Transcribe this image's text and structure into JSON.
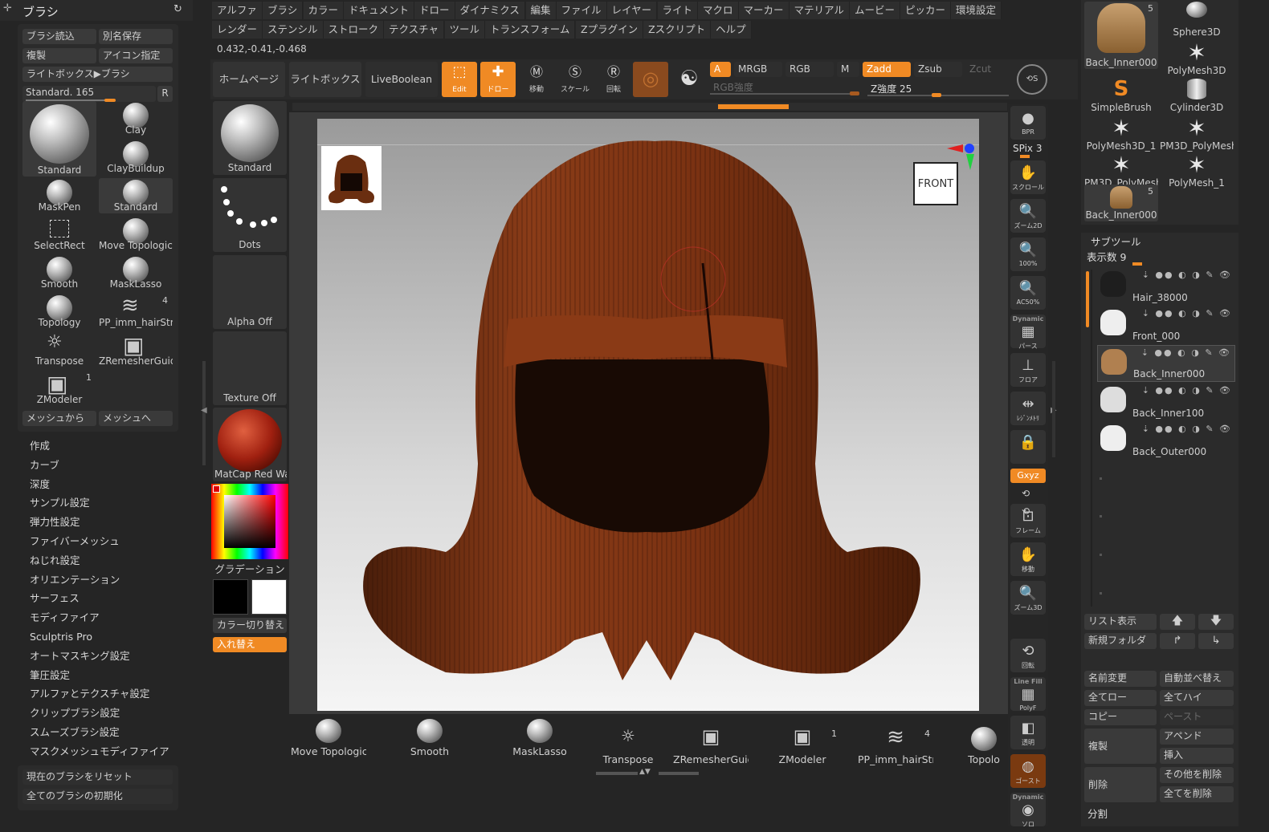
{
  "left": {
    "title": "ブラシ",
    "btns": [
      "ブラシ読込",
      "別名保存",
      "複製",
      "アイコン指定",
      "ライトボックス▶ブラシ"
    ],
    "current": "Standard. 165",
    "r": "R",
    "brushes": [
      {
        "name": "Standard",
        "kind": "sphere",
        "num": ""
      },
      {
        "name": "Clay",
        "kind": "sphere",
        "num": ""
      },
      {
        "name": "ClayBuildup",
        "kind": "sphere",
        "num": ""
      },
      {
        "name": "MaskPen",
        "kind": "sphere",
        "num": ""
      },
      {
        "name": "Standard",
        "kind": "sphere",
        "num": ""
      },
      {
        "name": "SelectRect",
        "kind": "rect",
        "num": ""
      },
      {
        "name": "Move Topologica",
        "kind": "sphere",
        "num": ""
      },
      {
        "name": "Smooth",
        "kind": "sphere",
        "num": ""
      },
      {
        "name": "MaskLasso",
        "kind": "sphere",
        "num": ""
      },
      {
        "name": "Topology",
        "kind": "sphere",
        "num": ""
      },
      {
        "name": "PP_imm_hairStr",
        "kind": "hair",
        "num": "4"
      },
      {
        "name": "Transpose",
        "kind": "gear",
        "num": ""
      },
      {
        "name": "ZRemesherGuide",
        "kind": "cube",
        "num": ""
      },
      {
        "name": "ZModeler",
        "kind": "cube",
        "num": "1"
      }
    ],
    "meshFrom": "メッシュから",
    "meshTo": "メッシュへ",
    "menu": [
      "作成",
      "カーブ",
      "深度",
      "サンプル設定",
      "弾力性設定",
      "ファイバーメッシュ",
      "ねじれ設定",
      "オリエンテーション",
      "サーフェス",
      "モディファイア",
      "Sculptris Pro",
      "オートマスキング設定",
      "筆圧設定",
      "アルファとテクスチャ設定",
      "クリップブラシ設定",
      "スムーズブラシ設定",
      "マスクメッシュモディファイア"
    ],
    "reset": "現在のブラシをリセット",
    "initAll": "全てのブラシの初期化"
  },
  "menubar": {
    "row1": [
      "アルファ",
      "ブラシ",
      "カラー",
      "ドキュメント",
      "ドロー",
      "ダイナミクス",
      "編集",
      "ファイル",
      "レイヤー",
      "ライト",
      "マクロ",
      "マーカー",
      "マテリアル",
      "ムービー",
      "ピッカー",
      "環境設定"
    ],
    "row2": [
      "レンダー",
      "ステンシル",
      "ストローク",
      "テクスチャ",
      "ツール",
      "トランスフォーム",
      "Zプラグイン",
      "Zスクリプト",
      "ヘルプ"
    ]
  },
  "coords": "0.432,-0.41,-0.468",
  "toolbar": {
    "home": "ホームページ",
    "lightbox": "ライトボックス",
    "liveboolean": "LiveBoolean",
    "edit": "Edit",
    "draw": "ドロー",
    "move": "移動",
    "scale": "スケール",
    "rotate": "回転",
    "a": "A",
    "mrgb": "MRGB",
    "rgb": "RGB",
    "m": "M",
    "zadd": "Zadd",
    "zsub": "Zsub",
    "zcut": "Zcut",
    "rgbIntensity": "RGB強度",
    "zIntensity": "Z強度 25"
  },
  "shelf": {
    "standard": "Standard",
    "dots": "Dots",
    "alpha": "Alpha Off",
    "texture": "Texture Off",
    "matcap": "MatCap Red Wa:",
    "gradation": "グラデーション",
    "colorSwitch": "カラー切り替え",
    "swap": "入れ替え"
  },
  "canvas": {
    "front": "FRONT"
  },
  "rightbar": {
    "bpr": "BPR",
    "spix": "SPix 3",
    "scroll": "スクロール",
    "zoom2d": "ズーム2D",
    "z100": "100%",
    "ac50": "AC50%",
    "dynamic": "Dynamic",
    "perspective": "パース",
    "floor": "フロア",
    "localsym": "ﾚｼﾞﾝﾒﾄﾘ",
    "xyz": "Gxyz",
    "frame": "フレーム",
    "move": "移動",
    "zoom3d": "ズーム3D",
    "rotate": "回転",
    "linefill": "Line Fill",
    "polyf": "PolyF",
    "transp": "透明",
    "ghost": "ゴースト",
    "solo": "ソロ"
  },
  "tools": [
    {
      "name": "Back_Inner000",
      "num": "5",
      "kind": "hair"
    },
    {
      "name": "Sphere3D",
      "num": "",
      "kind": "sphere"
    },
    {
      "name": "PolyMesh3D",
      "num": "",
      "kind": "star"
    },
    {
      "name": "SimpleBrush",
      "num": "",
      "kind": "s"
    },
    {
      "name": "Cylinder3D",
      "num": "",
      "kind": "cyl"
    },
    {
      "name": "PolyMesh3D_1",
      "num": "",
      "kind": "star"
    },
    {
      "name": "PM3D_PolyMesh",
      "num": "",
      "kind": "star"
    },
    {
      "name": "PM3D_PolyMesh",
      "num": "",
      "kind": "star"
    },
    {
      "name": "PolyMesh_1",
      "num": "",
      "kind": "star"
    },
    {
      "name": "Back_Inner000",
      "num": "5",
      "kind": "hair"
    }
  ],
  "subtool": {
    "title": "サブツール",
    "count": "表示数 9",
    "items": [
      "Hair_38000",
      "Front_000",
      "Back_Inner000",
      "Back_Inner100",
      "Back_Outer000"
    ],
    "listView": "リスト表示",
    "newFolder": "新規フォルダ",
    "rename": "名前変更",
    "autoSort": "自動並べ替え",
    "allLow": "全てロー",
    "allHigh": "全てハイ",
    "copy": "コピー",
    "paste": "ペースト",
    "duplicate": "複製",
    "append": "アペンド",
    "insert": "挿入",
    "delete": "削除",
    "delOther": "その他を削除",
    "delAll": "全てを削除",
    "split": "分割"
  },
  "bottomShelf": [
    {
      "name": "Move Topologica",
      "num": ""
    },
    {
      "name": "Smooth",
      "num": ""
    },
    {
      "name": "MaskLasso",
      "num": ""
    },
    {
      "name": "Transpose",
      "num": ""
    },
    {
      "name": "ZRemesherGuide",
      "num": ""
    },
    {
      "name": "ZModeler",
      "num": "1"
    },
    {
      "name": "PP_imm_hairStr",
      "num": "4"
    },
    {
      "name": "Topolo",
      "num": ""
    }
  ]
}
